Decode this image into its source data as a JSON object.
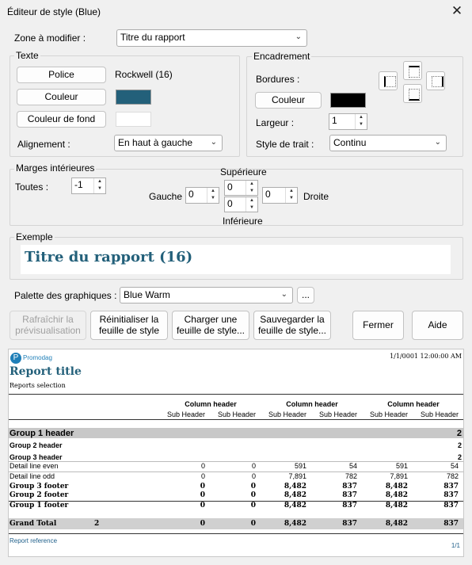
{
  "window": {
    "title": "Éditeur de style (Blue)",
    "close": "✕"
  },
  "zone": {
    "label": "Zone à modifier :",
    "value": "Titre du rapport"
  },
  "texte": {
    "title": "Texte",
    "font_button": "Police",
    "font_value": "Rockwell (16)",
    "color_button": "Couleur",
    "color": "#23607a",
    "bgcolor_button": "Couleur de fond",
    "bgcolor": "#ffffff",
    "align_label": "Alignement :",
    "align_value": "En haut à gauche"
  },
  "encadrement": {
    "title": "Encadrement",
    "borders_label": "Bordures :",
    "color_button": "Couleur",
    "color": "#000000",
    "width_label": "Largeur :",
    "width_value": "1",
    "style_label": "Style de trait :",
    "style_value": "Continu"
  },
  "marges": {
    "title": "Marges intérieures",
    "all_label": "Toutes :",
    "all_value": "-1",
    "top_label": "Supérieure",
    "bottom_label": "Inférieure",
    "left_label": "Gauche",
    "right_label": "Droite",
    "left_value": "0",
    "top_value": "0",
    "bottom_value": "0",
    "right_value": "0"
  },
  "exemple": {
    "title": "Exemple",
    "text": "Titre du rapport (16)"
  },
  "palette": {
    "label": "Palette des graphiques :",
    "value": "Blue Warm",
    "more": "..."
  },
  "actions": {
    "refresh": "Rafraîchir la prévisualisation",
    "reset": "Réinitialiser la feuille de style",
    "load": "Charger une feuille de style...",
    "save": "Sauvegarder la feuille de style...",
    "close": "Fermer",
    "help": "Aide"
  },
  "report": {
    "logo": "Promodag",
    "date": "1/1/0001 12:00:00 AM",
    "title": "Report title",
    "selection": "Reports selection",
    "column_header": "Column header",
    "sub_header": "Sub Header",
    "group1": "Group 1 header",
    "group2": "Group 2 header",
    "group3": "Group 3 header",
    "count": "2",
    "rows": [
      {
        "label": "Detail line even",
        "values": [
          "0",
          "0",
          "591",
          "54",
          "591",
          "54"
        ]
      },
      {
        "label": "Detail line odd",
        "values": [
          "0",
          "0",
          "7,891",
          "782",
          "7,891",
          "782"
        ]
      },
      {
        "label": "Group 3 footer",
        "values": [
          "0",
          "0",
          "8,482",
          "837",
          "8,482",
          "837"
        ]
      },
      {
        "label": "Group 2 footer",
        "values": [
          "0",
          "0",
          "8,482",
          "837",
          "8,482",
          "837"
        ]
      },
      {
        "label": "Group 1 footer",
        "values": [
          "0",
          "0",
          "8,482",
          "837",
          "8,482",
          "837"
        ]
      }
    ],
    "grand_total": {
      "label": "Grand Total",
      "count": "2",
      "values": [
        "0",
        "0",
        "8,482",
        "837",
        "8,482",
        "837"
      ]
    },
    "reference": "Report reference",
    "page": "1/1"
  }
}
